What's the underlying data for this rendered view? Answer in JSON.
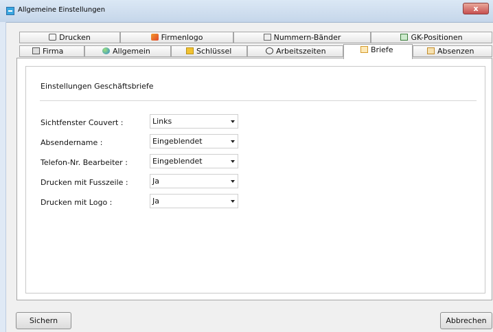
{
  "window": {
    "title": "Allgemeine Einstellungen",
    "close_label": "x"
  },
  "tabs_row1": [
    {
      "label": "Drucken",
      "icon": "printer-icon"
    },
    {
      "label": "Firmenlogo",
      "icon": "brush-icon"
    },
    {
      "label": "Nummern-Bänder",
      "icon": "numbers-icon"
    },
    {
      "label": "GK-Positionen",
      "icon": "table-icon"
    }
  ],
  "tabs_row2": [
    {
      "label": "Firma",
      "icon": "building-icon"
    },
    {
      "label": "Allgemein",
      "icon": "globe-icon"
    },
    {
      "label": "Schlüssel",
      "icon": "key-icon"
    },
    {
      "label": "Arbeitszeiten",
      "icon": "clock-icon"
    },
    {
      "label": "Briefe",
      "icon": "envelope-icon",
      "active": true
    },
    {
      "label": "Absenzen",
      "icon": "absence-icon"
    }
  ],
  "section": {
    "title": "Einstellungen Geschäftsbriefe"
  },
  "fields": [
    {
      "label": "Sichtfenster Couvert :",
      "value": "Links"
    },
    {
      "label": "Absendername :",
      "value": "Eingeblendet"
    },
    {
      "label": "Telefon-Nr. Bearbeiter :",
      "value": "Eingeblendet"
    },
    {
      "label": "Drucken mit Fusszeile :",
      "value": "Ja"
    },
    {
      "label": "Drucken mit Logo :",
      "value": "Ja"
    }
  ],
  "buttons": {
    "save": "Sichern",
    "cancel": "Abbrechen"
  },
  "colors": {
    "accent": "#3aa7e0",
    "close": "#c75050"
  }
}
